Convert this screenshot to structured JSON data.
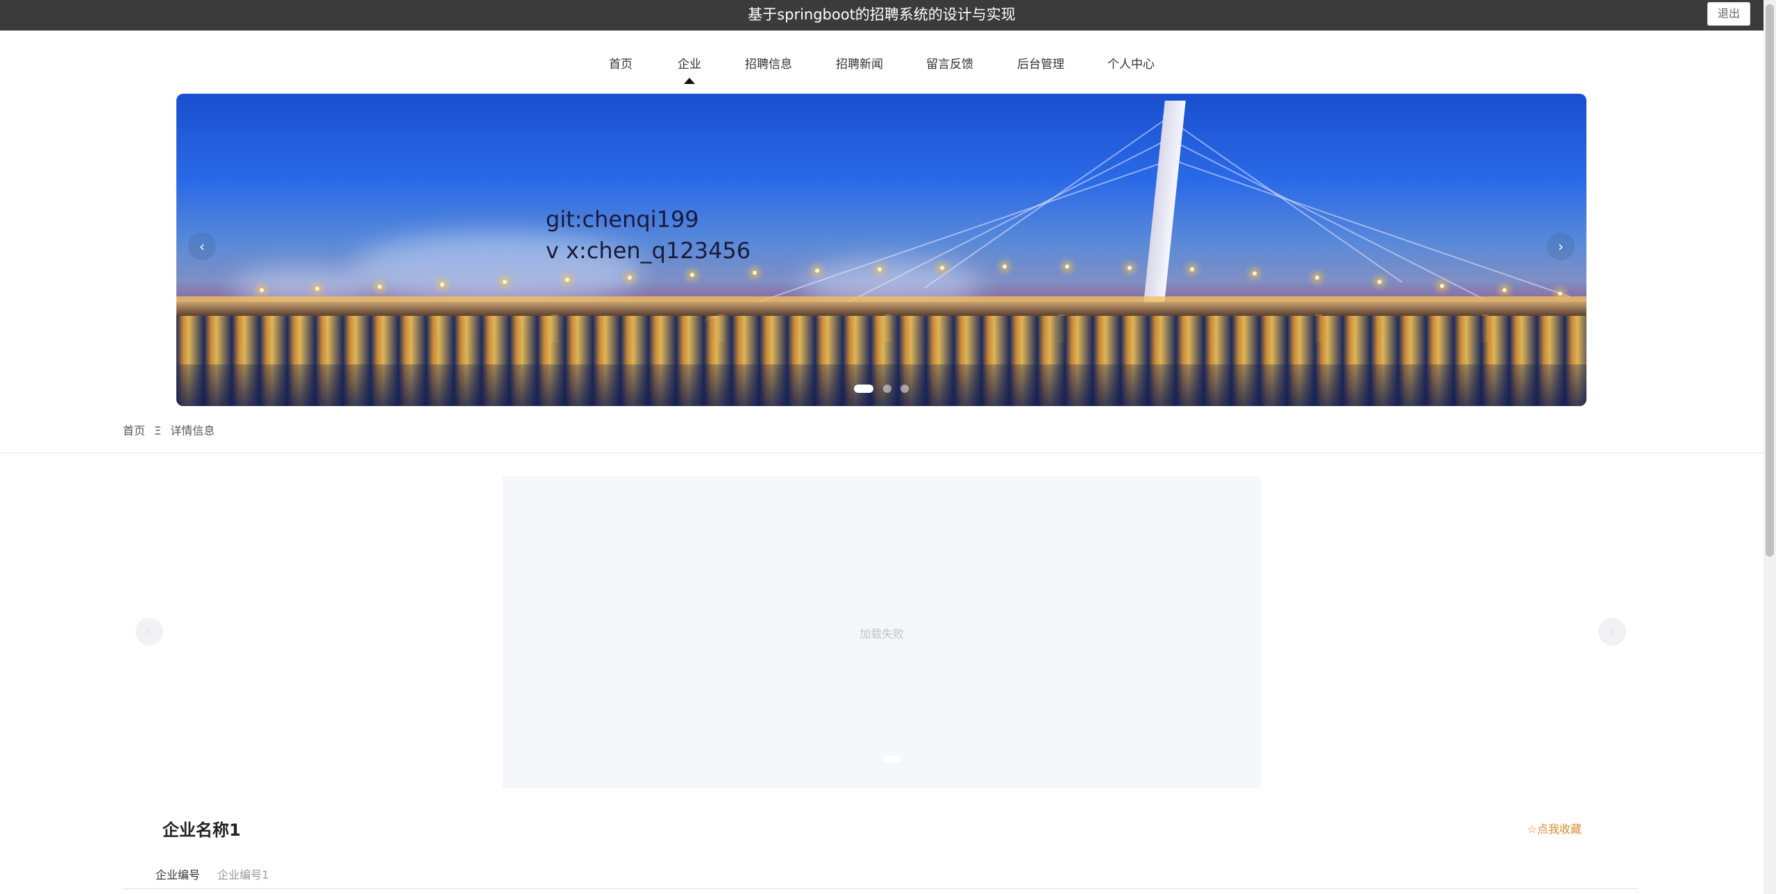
{
  "header": {
    "title": "基于springboot的招聘系统的设计与实现",
    "logout_label": "退出"
  },
  "nav": {
    "items": [
      {
        "label": "首页"
      },
      {
        "label": "企业"
      },
      {
        "label": "招聘信息"
      },
      {
        "label": "招聘新闻"
      },
      {
        "label": "留言反馈"
      },
      {
        "label": "后台管理"
      },
      {
        "label": "个人中心"
      }
    ],
    "active_item": "企业"
  },
  "banner": {
    "lines": [
      "git:chenqi199",
      "v x:chen_q123456"
    ],
    "prev_icon": "‹",
    "next_icon": "›",
    "slide_count": 3,
    "active_slide": 1
  },
  "breadcrumb": {
    "home": "首页",
    "separator": "Ξ",
    "current": "详情信息"
  },
  "detail_carousel": {
    "error_text": "加载失败",
    "prev_icon": "‹",
    "next_icon": "›"
  },
  "company": {
    "name": "企业名称1",
    "favorite_label": "☆点我收藏",
    "fields": [
      {
        "label": "企业编号",
        "value": "企业编号1"
      }
    ]
  },
  "colors": {
    "topbar": "#3b3b3b",
    "accent_orange": "#e08a2c"
  }
}
